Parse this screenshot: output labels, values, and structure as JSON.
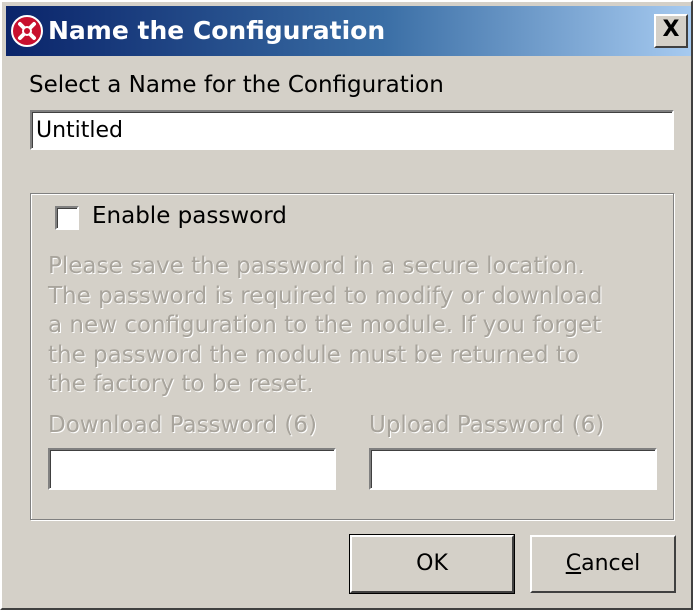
{
  "window": {
    "title": "Name the Configuration",
    "close_label": "X"
  },
  "name_section": {
    "label": "Select a Name for the Configuration",
    "value": "Untitled"
  },
  "password_group": {
    "checkbox_label": "Enable password",
    "checked": false,
    "warning": "Please save the password in a secure location.\nThe password is required to modify or download\na new configuration to the module. If you forget\nthe password the module must be returned to\nthe factory to be reset.",
    "download_label": "Download Password (6)",
    "download_value": "",
    "upload_label": "Upload Password (6)",
    "upload_value": ""
  },
  "buttons": {
    "ok": "OK",
    "cancel_mnemonic": "C",
    "cancel_rest": "ancel"
  },
  "colors": {
    "dialog_bg": "#d4d0c8",
    "title_start": "#0a246a",
    "title_end": "#a6caf0",
    "disabled_text": "#a8a49c"
  }
}
